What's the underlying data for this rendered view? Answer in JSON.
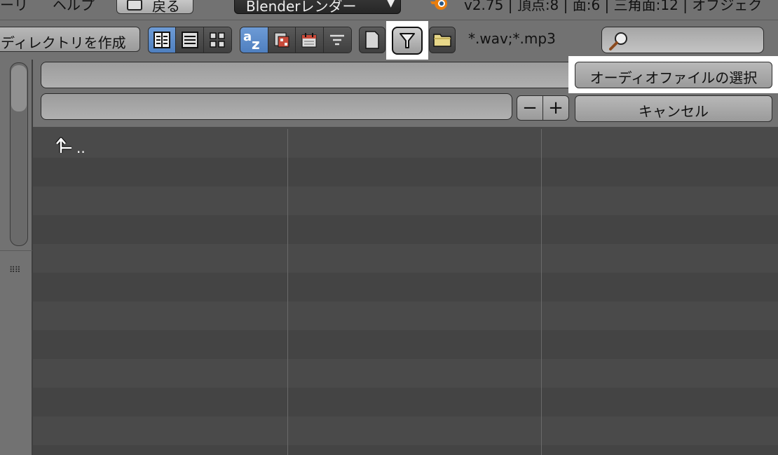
{
  "top_header": {
    "menu_tail": "ーリ",
    "help_menu": "ヘルプ",
    "back_label": "戻る",
    "render_engine": "Blenderレンダー",
    "stats": "v2.75 | 頂点:8 | 面:6 | 三角面:12 | オブジェク"
  },
  "toolbar": {
    "create_dir_label": "ディレクトリを作成",
    "display_modes": [
      "short-list-icon",
      "long-list-icon",
      "thumbnails-icon"
    ],
    "sort_modes": [
      "sort-alpha-icon",
      "sort-ext-icon",
      "sort-time-icon",
      "sort-size-icon"
    ],
    "filter_glob": "*.wav;*.mp3",
    "search_placeholder": ""
  },
  "path_panel": {
    "directory_value": "",
    "filename_value": "",
    "select_button": "オーディオファイルの選択",
    "cancel_button": "キャンセル",
    "minus_label": "−",
    "plus_label": "+"
  },
  "file_list": {
    "parent_label": ".."
  },
  "colors": {
    "header_bg": "#727272",
    "list_bg": "#4a4a4a",
    "active_blue": "#5a8ad0",
    "highlight": "#ffffff"
  }
}
